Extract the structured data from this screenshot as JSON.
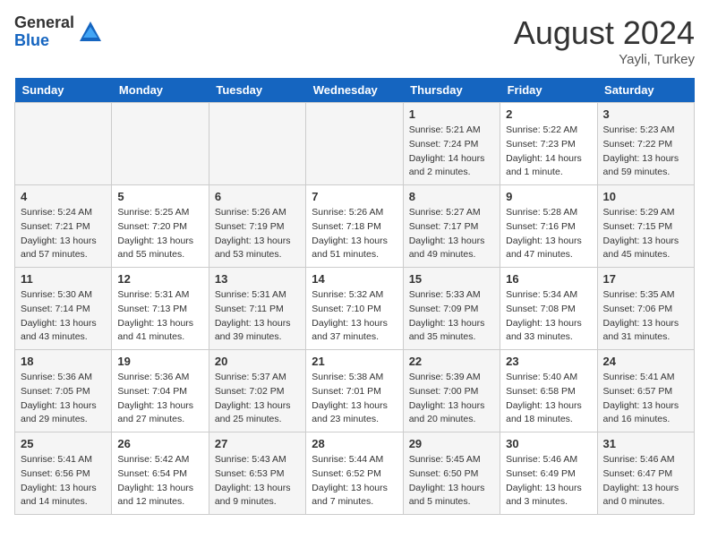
{
  "header": {
    "logo_general": "General",
    "logo_blue": "Blue",
    "month_year": "August 2024",
    "location": "Yayli, Turkey"
  },
  "weekdays": [
    "Sunday",
    "Monday",
    "Tuesday",
    "Wednesday",
    "Thursday",
    "Friday",
    "Saturday"
  ],
  "weeks": [
    [
      {
        "day": "",
        "empty": true
      },
      {
        "day": "",
        "empty": true
      },
      {
        "day": "",
        "empty": true
      },
      {
        "day": "",
        "empty": true
      },
      {
        "day": "1",
        "sunrise": "5:21 AM",
        "sunset": "7:24 PM",
        "daylight": "14 hours and 2 minutes."
      },
      {
        "day": "2",
        "sunrise": "5:22 AM",
        "sunset": "7:23 PM",
        "daylight": "14 hours and 1 minute."
      },
      {
        "day": "3",
        "sunrise": "5:23 AM",
        "sunset": "7:22 PM",
        "daylight": "13 hours and 59 minutes."
      }
    ],
    [
      {
        "day": "4",
        "sunrise": "5:24 AM",
        "sunset": "7:21 PM",
        "daylight": "13 hours and 57 minutes."
      },
      {
        "day": "5",
        "sunrise": "5:25 AM",
        "sunset": "7:20 PM",
        "daylight": "13 hours and 55 minutes."
      },
      {
        "day": "6",
        "sunrise": "5:26 AM",
        "sunset": "7:19 PM",
        "daylight": "13 hours and 53 minutes."
      },
      {
        "day": "7",
        "sunrise": "5:26 AM",
        "sunset": "7:18 PM",
        "daylight": "13 hours and 51 minutes."
      },
      {
        "day": "8",
        "sunrise": "5:27 AM",
        "sunset": "7:17 PM",
        "daylight": "13 hours and 49 minutes."
      },
      {
        "day": "9",
        "sunrise": "5:28 AM",
        "sunset": "7:16 PM",
        "daylight": "13 hours and 47 minutes."
      },
      {
        "day": "10",
        "sunrise": "5:29 AM",
        "sunset": "7:15 PM",
        "daylight": "13 hours and 45 minutes."
      }
    ],
    [
      {
        "day": "11",
        "sunrise": "5:30 AM",
        "sunset": "7:14 PM",
        "daylight": "13 hours and 43 minutes."
      },
      {
        "day": "12",
        "sunrise": "5:31 AM",
        "sunset": "7:13 PM",
        "daylight": "13 hours and 41 minutes."
      },
      {
        "day": "13",
        "sunrise": "5:31 AM",
        "sunset": "7:11 PM",
        "daylight": "13 hours and 39 minutes."
      },
      {
        "day": "14",
        "sunrise": "5:32 AM",
        "sunset": "7:10 PM",
        "daylight": "13 hours and 37 minutes."
      },
      {
        "day": "15",
        "sunrise": "5:33 AM",
        "sunset": "7:09 PM",
        "daylight": "13 hours and 35 minutes."
      },
      {
        "day": "16",
        "sunrise": "5:34 AM",
        "sunset": "7:08 PM",
        "daylight": "13 hours and 33 minutes."
      },
      {
        "day": "17",
        "sunrise": "5:35 AM",
        "sunset": "7:06 PM",
        "daylight": "13 hours and 31 minutes."
      }
    ],
    [
      {
        "day": "18",
        "sunrise": "5:36 AM",
        "sunset": "7:05 PM",
        "daylight": "13 hours and 29 minutes."
      },
      {
        "day": "19",
        "sunrise": "5:36 AM",
        "sunset": "7:04 PM",
        "daylight": "13 hours and 27 minutes."
      },
      {
        "day": "20",
        "sunrise": "5:37 AM",
        "sunset": "7:02 PM",
        "daylight": "13 hours and 25 minutes."
      },
      {
        "day": "21",
        "sunrise": "5:38 AM",
        "sunset": "7:01 PM",
        "daylight": "13 hours and 23 minutes."
      },
      {
        "day": "22",
        "sunrise": "5:39 AM",
        "sunset": "7:00 PM",
        "daylight": "13 hours and 20 minutes."
      },
      {
        "day": "23",
        "sunrise": "5:40 AM",
        "sunset": "6:58 PM",
        "daylight": "13 hours and 18 minutes."
      },
      {
        "day": "24",
        "sunrise": "5:41 AM",
        "sunset": "6:57 PM",
        "daylight": "13 hours and 16 minutes."
      }
    ],
    [
      {
        "day": "25",
        "sunrise": "5:41 AM",
        "sunset": "6:56 PM",
        "daylight": "13 hours and 14 minutes."
      },
      {
        "day": "26",
        "sunrise": "5:42 AM",
        "sunset": "6:54 PM",
        "daylight": "13 hours and 12 minutes."
      },
      {
        "day": "27",
        "sunrise": "5:43 AM",
        "sunset": "6:53 PM",
        "daylight": "13 hours and 9 minutes."
      },
      {
        "day": "28",
        "sunrise": "5:44 AM",
        "sunset": "6:52 PM",
        "daylight": "13 hours and 7 minutes."
      },
      {
        "day": "29",
        "sunrise": "5:45 AM",
        "sunset": "6:50 PM",
        "daylight": "13 hours and 5 minutes."
      },
      {
        "day": "30",
        "sunrise": "5:46 AM",
        "sunset": "6:49 PM",
        "daylight": "13 hours and 3 minutes."
      },
      {
        "day": "31",
        "sunrise": "5:46 AM",
        "sunset": "6:47 PM",
        "daylight": "13 hours and 0 minutes."
      }
    ]
  ],
  "labels": {
    "sunrise_prefix": "Sunrise: ",
    "sunset_prefix": "Sunset: ",
    "daylight_prefix": "Daylight: "
  }
}
